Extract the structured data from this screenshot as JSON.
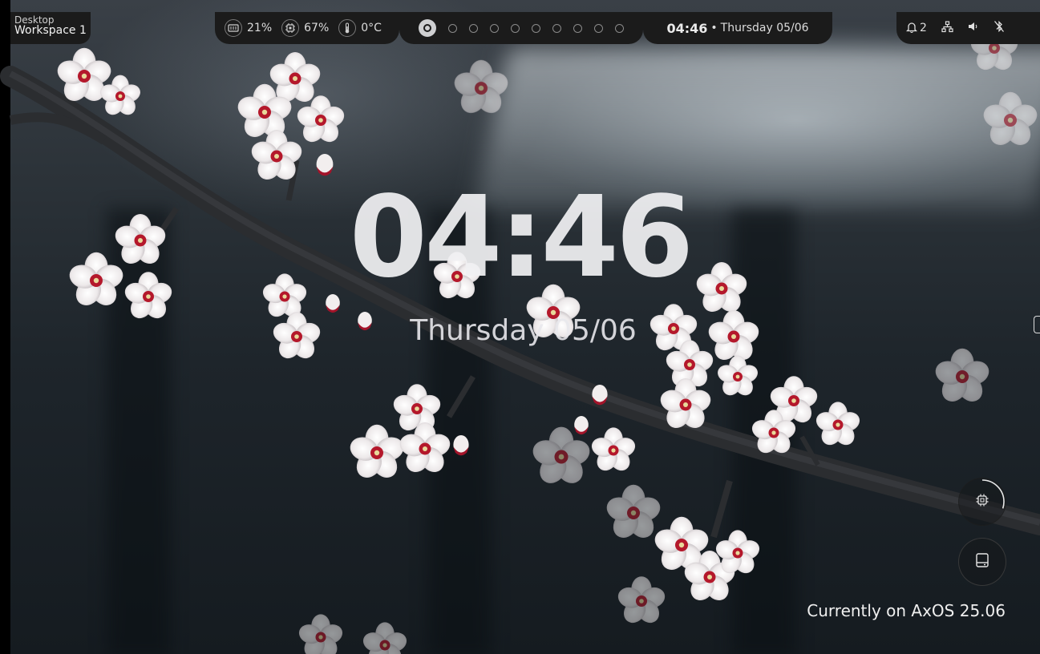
{
  "workspace": {
    "group": "Desktop",
    "name": "Workspace 1"
  },
  "stats": [
    {
      "icon": "memory-icon",
      "value": "21%"
    },
    {
      "icon": "cpu-icon",
      "value": "67%"
    },
    {
      "icon": "thermometer-icon",
      "value": "0°C"
    }
  ],
  "workspaces": {
    "count": 10,
    "active": 1
  },
  "bar_clock": {
    "time": "04:46",
    "separator": "•",
    "date": "Thursday 05/06"
  },
  "tray": {
    "notifications": "2"
  },
  "desktop_clock": {
    "time": "04:46",
    "date": "Thursday 05/06"
  },
  "widgets": {
    "cpu_level": 0.3
  },
  "status_text": "Currently on AxOS 25.06",
  "colors": {
    "bar_bg": "#1b1b1b",
    "blossom": "#f4f1f1",
    "blossom_center": "#b4182b",
    "branch": "#2a2c2e"
  }
}
